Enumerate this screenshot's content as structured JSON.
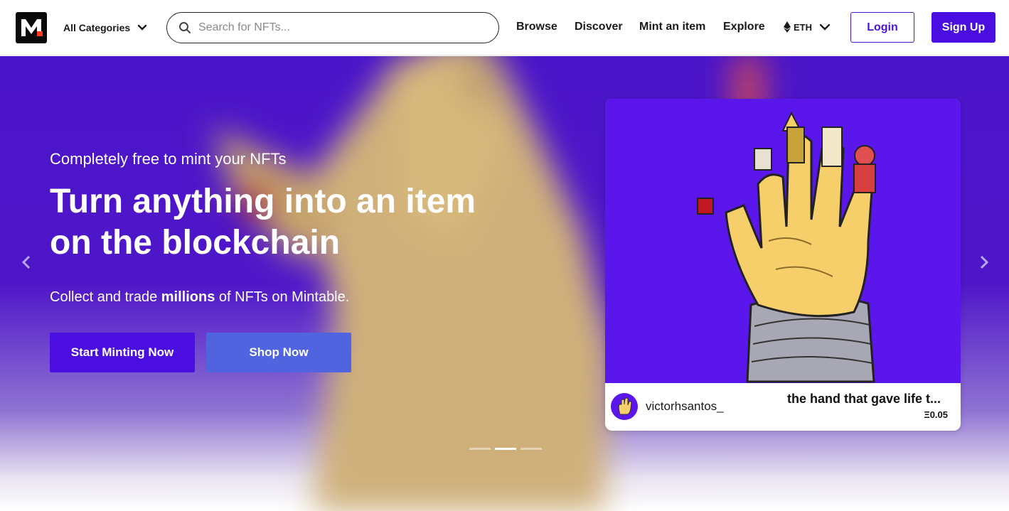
{
  "header": {
    "logo_icon": "mintable-logo-icon",
    "categories_label": "All Categories",
    "search": {
      "placeholder": "Search for NFTs...",
      "value": ""
    },
    "nav": [
      {
        "label": "Browse"
      },
      {
        "label": "Discover"
      },
      {
        "label": "Mint an item"
      },
      {
        "label": "Explore"
      }
    ],
    "currency": {
      "icon": "ethereum-icon",
      "label": "ETH"
    },
    "login_label": "Login",
    "signup_label": "Sign Up"
  },
  "hero": {
    "subtitle": "Completely free to mint your NFTs",
    "headline_line1": "Turn anything into an item",
    "headline_line2": "on the blockchain",
    "tagline_pre": "Collect and trade ",
    "tagline_bold": "millions",
    "tagline_post": " of NFTs on Mintable.",
    "start_button": "Start Minting Now",
    "shop_button": "Shop Now",
    "slides_total": 3,
    "active_slide": 2
  },
  "featured": {
    "creator": "victorhsantos_",
    "title": "the hand that gave life t...",
    "price": "Ξ0.05"
  },
  "colors": {
    "brand_purple": "#4a0fe0",
    "shop_blue": "#5064e0",
    "card_art_bg": "#5b16ec"
  }
}
